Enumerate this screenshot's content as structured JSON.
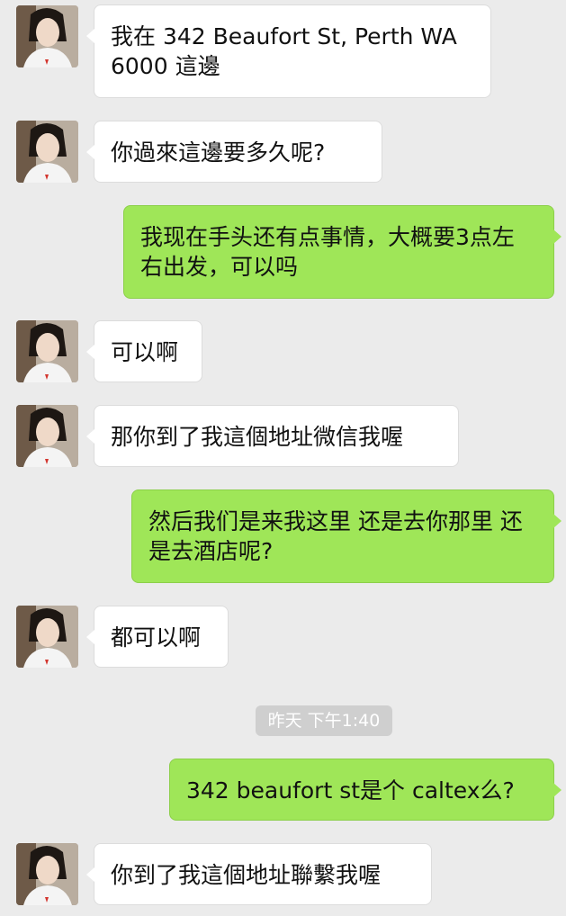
{
  "conversation": {
    "messages": [
      {
        "sender": "contact",
        "text": "我在 342 Beaufort St, Perth WA 6000 這邊"
      },
      {
        "sender": "contact",
        "text": "你過來這邊要多久呢?"
      },
      {
        "sender": "me",
        "text": "我现在手头还有点事情，大概要3点左右出发，可以吗"
      },
      {
        "sender": "contact",
        "text": "可以啊"
      },
      {
        "sender": "contact",
        "text": "那你到了我這個地址微信我喔"
      },
      {
        "sender": "me",
        "text": "然后我们是来我这里 还是去你那里 还是去酒店呢?"
      },
      {
        "sender": "contact",
        "text": "都可以啊"
      },
      {
        "sender": "me",
        "text": "342 beaufort st是个 caltex么?"
      },
      {
        "sender": "contact",
        "text": "你到了我這個地址聯繫我喔"
      }
    ],
    "timestamp": "昨天 下午1:40"
  },
  "colors": {
    "background": "#ebebeb",
    "incoming_bubble": "#ffffff",
    "outgoing_bubble": "#9fe658",
    "timestamp_pill": "#cfcfcf"
  },
  "icons": {
    "contact_avatar": "contact-avatar-photo"
  }
}
